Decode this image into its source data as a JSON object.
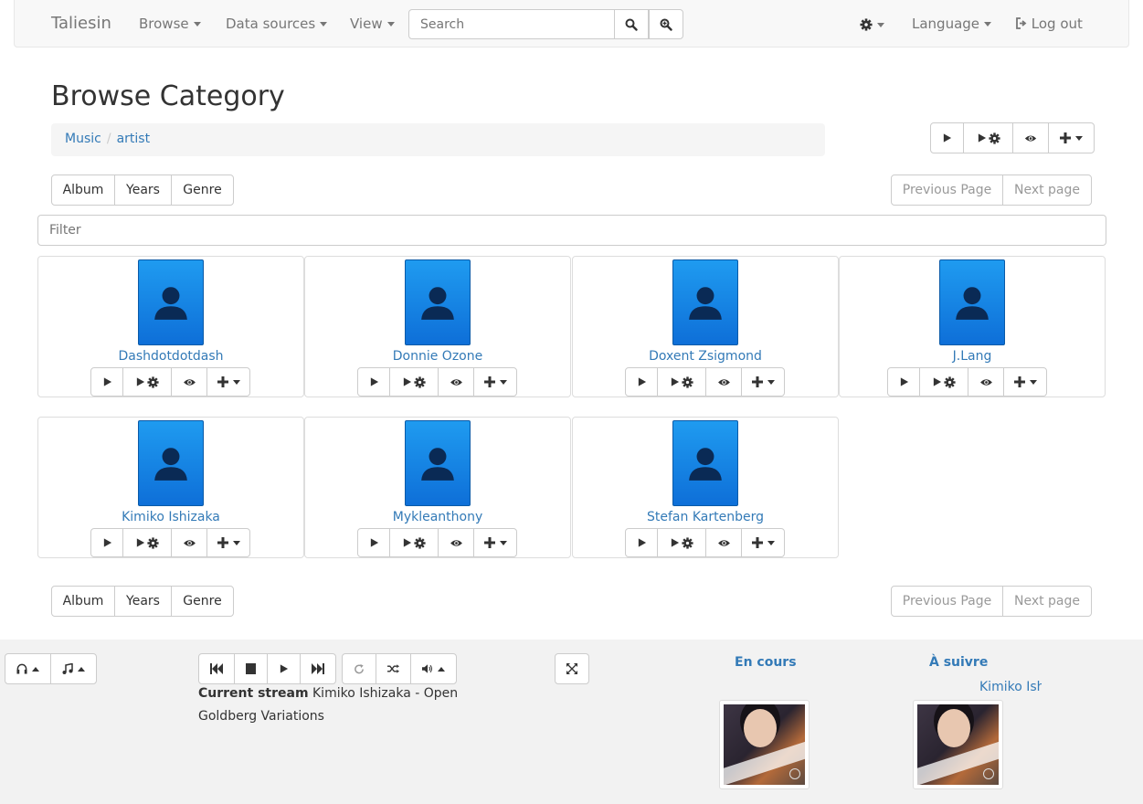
{
  "navbar": {
    "brand": "Taliesin",
    "browse": "Browse",
    "data_sources": "Data sources",
    "view": "View",
    "search_placeholder": "Search",
    "language": "Language",
    "logout": "Log out"
  },
  "page": {
    "title": "Browse Category",
    "breadcrumb": [
      "Music",
      "artist"
    ]
  },
  "category_buttons": [
    "Album",
    "Years",
    "Genre"
  ],
  "pagination": {
    "previous": "Previous Page",
    "next": "Next page"
  },
  "filter_placeholder": "Filter",
  "artists": [
    "Dashdotdotdash",
    "Donnie Ozone",
    "Doxent Zsigmond",
    "J.Lang",
    "Kimiko Ishizaka",
    "Mykleanthony",
    "Stefan Kartenberg"
  ],
  "player": {
    "current_stream_label": "Current stream",
    "current_stream_value": "Kimiko Ishizaka - Open Goldberg Variations",
    "now_playing_title": "En cours",
    "up_next_title": "À suivre",
    "up_next_item": "Kimiko Ishizaka"
  },
  "colors": {
    "link": "#337ab7",
    "avatar": "#1f9bf0"
  },
  "icons": [
    "search-icon",
    "zoom-in-icon",
    "gear-icon",
    "logout-icon",
    "play-icon",
    "play-settings-icon",
    "eye-icon",
    "plus-icon",
    "user-icon",
    "headphones-icon",
    "music-icon",
    "step-backward-icon",
    "stop-icon",
    "step-forward-icon",
    "repeat-icon",
    "shuffle-icon",
    "volume-icon",
    "fullscreen-icon"
  ]
}
